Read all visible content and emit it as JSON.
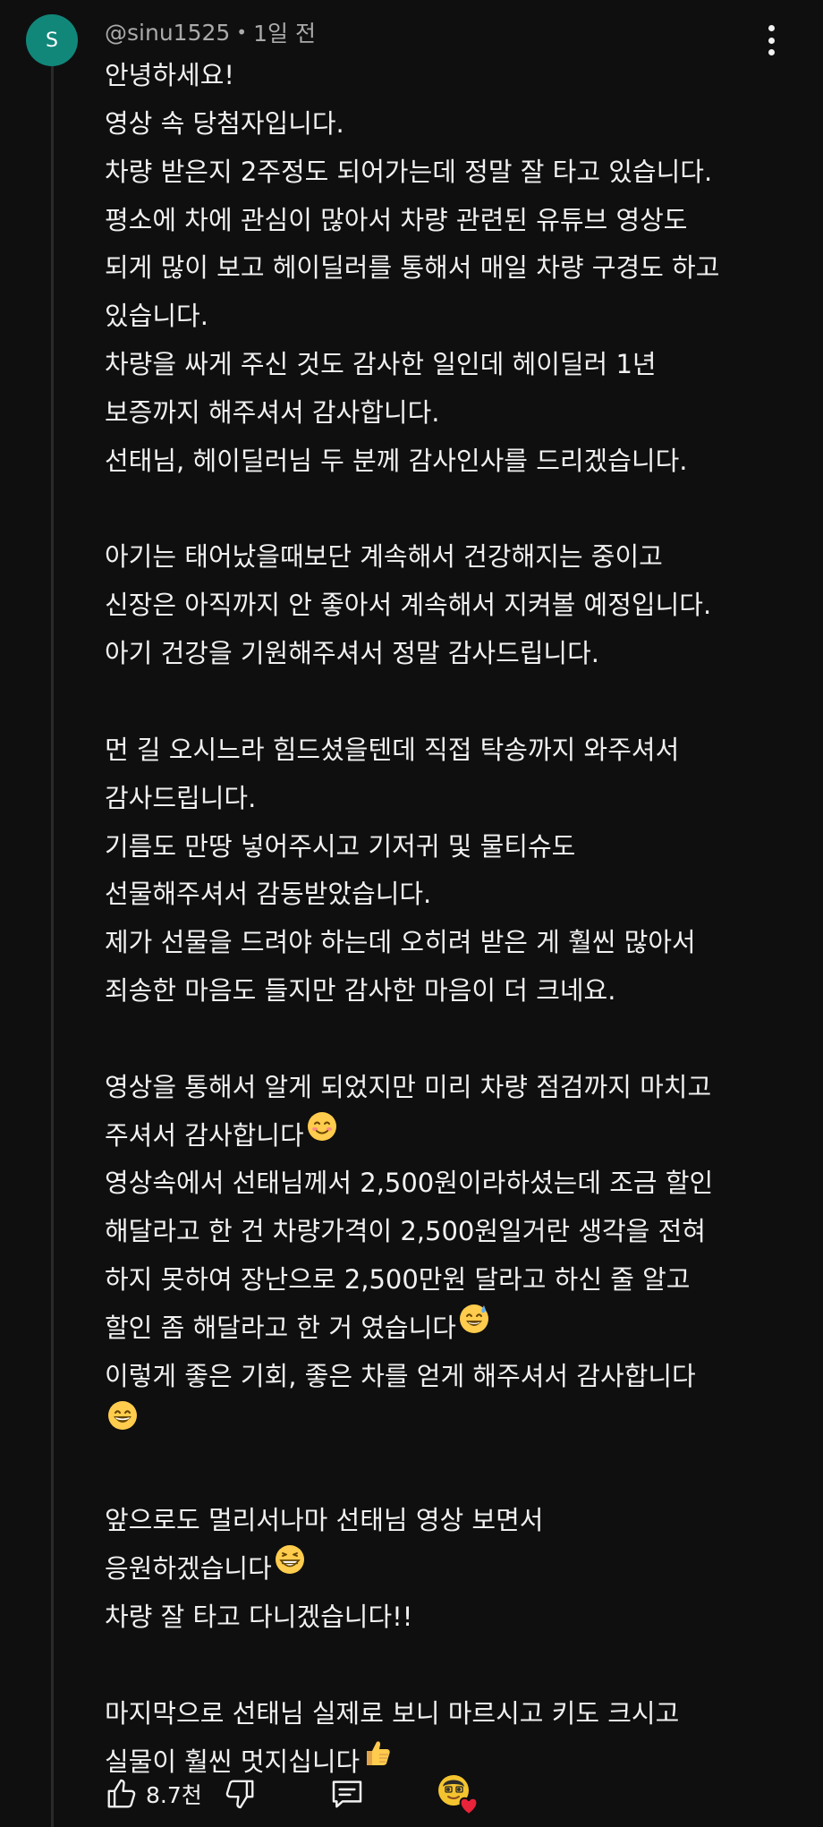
{
  "comment": {
    "avatar_letter": "S",
    "avatar_color": "#11877a",
    "author": "@sinu1525",
    "separator": "•",
    "time": "1일 전",
    "lines": [
      {
        "text": "안녕하세요!"
      },
      {
        "text": "영상 속 당첨자입니다."
      },
      {
        "text": "차량 받은지 2주정도 되어가는데 정말 잘 타고 있습니다."
      },
      {
        "text": "평소에 차에 관심이 많아서 차량 관련된 유튜브 영상도"
      },
      {
        "text": "되게 많이 보고 헤이딜러를 통해서 매일 차량 구경도 하고"
      },
      {
        "text": "있습니다."
      },
      {
        "text": "차량을 싸게 주신 것도 감사한 일인데 헤이딜러 1년"
      },
      {
        "text": "보증까지 해주셔서 감사합니다."
      },
      {
        "text": "선태님, 헤이딜러님 두 분께 감사인사를 드리겠습니다."
      },
      {
        "text": ""
      },
      {
        "text": "아기는 태어났을때보단 계속해서 건강해지는 중이고"
      },
      {
        "text": "신장은 아직까지 안 좋아서 계속해서 지켜볼 예정입니다."
      },
      {
        "text": "아기 건강을 기원해주셔서 정말 감사드립니다."
      },
      {
        "text": ""
      },
      {
        "text": "먼 길 오시느라 힘드셨을텐데 직접 탁송까지 와주셔서"
      },
      {
        "text": "감사드립니다."
      },
      {
        "text": "기름도 만땅 넣어주시고 기저귀 및 물티슈도"
      },
      {
        "text": "선물해주셔서 감동받았습니다."
      },
      {
        "text": "제가 선물을 드려야 하는데 오히려 받은 게 훨씬 많아서"
      },
      {
        "text": "죄송한 마음도 들지만 감사한 마음이 더 크네요."
      },
      {
        "text": ""
      },
      {
        "text": "영상을 통해서 알게 되었지만 미리 차량 점검까지 마치고"
      },
      {
        "text": "주셔서 감사합니다",
        "emoji": "smiling-face"
      },
      {
        "text": "영상속에서 선태님께서 2,500원이라하셨는데 조금 할인"
      },
      {
        "text": "해달라고 한 건 차량가격이 2,500원일거란 생각을 전혀"
      },
      {
        "text": "하지 못하여 장난으로 2,500만원 달라고 하신 줄 알고"
      },
      {
        "text": "할인 좀 해달라고 한 거 였습니다",
        "emoji": "sweat-smile-face"
      },
      {
        "text": "이렇게 좋은 기회, 좋은 차를 얻게 해주셔서 감사합니다"
      },
      {
        "text": "",
        "emoji": "grinning-face"
      },
      {
        "text": ""
      },
      {
        "text": "앞으로도 멀리서나마 선태님 영상 보면서"
      },
      {
        "text": "응원하겠습니다",
        "emoji": "beaming-face"
      },
      {
        "text": "차량 잘 타고 다니겠습니다!!"
      },
      {
        "text": ""
      },
      {
        "text": "마지막으로 선태님 실제로 보니 마르시고 키도 크시고"
      },
      {
        "text": "실물이 훨씬 멋지십니다",
        "emoji": "thumbs-up"
      }
    ]
  },
  "actions": {
    "like_icon": "thumbs-up-outline-icon",
    "like_count": "8.7천",
    "dislike_icon": "thumbs-down-outline-icon",
    "reply_icon": "comment-icon",
    "creator_heart_icon": "creator-heart-icon"
  }
}
